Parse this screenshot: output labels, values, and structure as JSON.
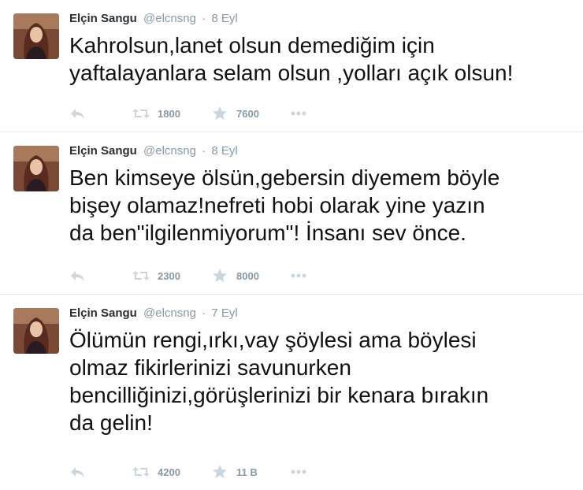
{
  "colors": {
    "name": "#292f33",
    "muted": "#8899a6",
    "text": "#111111",
    "divider": "#e1e8ed"
  },
  "tweets": [
    {
      "fullname": "Elçin Sangu",
      "username": "@elcnsng",
      "separator": "·",
      "time": "8 Eyl",
      "text": "Kahrolsun,lanet olsun demediğim için\nyaftalayanlara selam olsun ,yolları açık olsun!",
      "retweets": "1800",
      "favorites": "7600",
      "icons": [
        "reply-icon",
        "retweet-icon",
        "favorite-star-icon",
        "more-icon"
      ]
    },
    {
      "fullname": "Elçin Sangu",
      "username": "@elcnsng",
      "separator": "·",
      "time": "8 Eyl",
      "text": "Ben kimseye ölsün,gebersin diyemem böyle\nbişey olamaz!nefreti hobi olarak yine yazın\nda ben\"ilgilenmiyorum\"! İnsanı sev önce.",
      "retweets": "2300",
      "favorites": "8000",
      "icons": [
        "reply-icon",
        "retweet-icon",
        "favorite-star-icon",
        "more-icon"
      ]
    },
    {
      "fullname": "Elçin Sangu",
      "username": "@elcnsng",
      "separator": "·",
      "time": "7 Eyl",
      "text": "Ölümün rengi,ırkı,vay şöylesi ama böylesi\nolmaz fikirlerinizi savunurken\nbencilliğinizi,görüşlerinizi bir kenara bırakın\nda gelin!",
      "retweets": "4200",
      "favorites": "11 B",
      "icons": [
        "reply-icon",
        "retweet-icon",
        "favorite-star-icon",
        "more-icon"
      ]
    }
  ]
}
